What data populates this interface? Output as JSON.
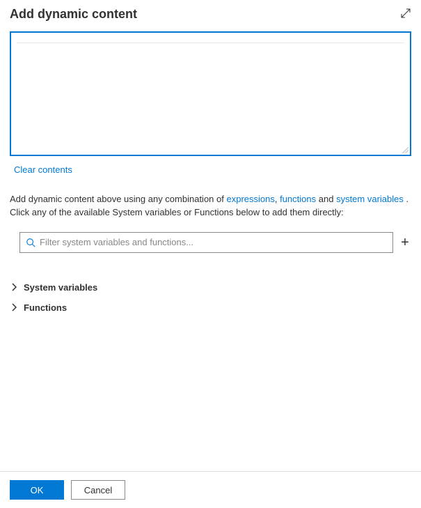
{
  "header": {
    "title": "Add dynamic content"
  },
  "editor": {
    "value": "",
    "clear_label": "Clear contents"
  },
  "help": {
    "prefix": "Add dynamic content above using any combination of ",
    "link_expressions": "expressions",
    "sep1": ", ",
    "link_functions": "functions",
    "sep2": " and ",
    "link_system_variables": "system variables",
    "sep3": " . ",
    "suffix": "Click any of the available System variables or Functions below to add them directly:"
  },
  "filter": {
    "placeholder": "Filter system variables and functions..."
  },
  "tree": {
    "items": [
      {
        "label": "System variables"
      },
      {
        "label": "Functions"
      }
    ]
  },
  "footer": {
    "ok": "OK",
    "cancel": "Cancel"
  }
}
